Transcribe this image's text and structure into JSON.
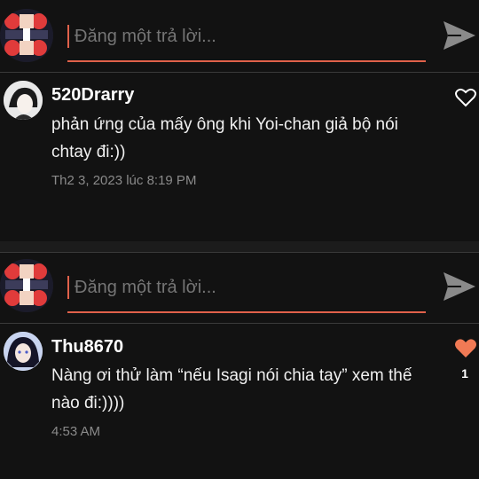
{
  "reply_bar": {
    "placeholder": "Đăng một trả lời...",
    "accent_color": "#e0614a"
  },
  "comments": [
    {
      "username": "520Drarry",
      "text": "phản ứng của mấy ông khi Yoi-chan giả bộ nói chtay đi:))",
      "timestamp": "Th2 3, 2023 lúc 8:19 PM",
      "liked": false,
      "likes": ""
    },
    {
      "username": "Thu8670",
      "text": "Nàng ơi thử làm “nếu Isagi nói chia tay” xem thế nào đi:))))",
      "timestamp": "4:53 AM",
      "liked": true,
      "likes": "1"
    }
  ],
  "colors": {
    "heart_liked": "#f07a55",
    "background": "#121212"
  },
  "icons": {
    "send": "send-icon",
    "heart_outline": "heart-outline-icon",
    "heart_filled": "heart-filled-icon"
  }
}
